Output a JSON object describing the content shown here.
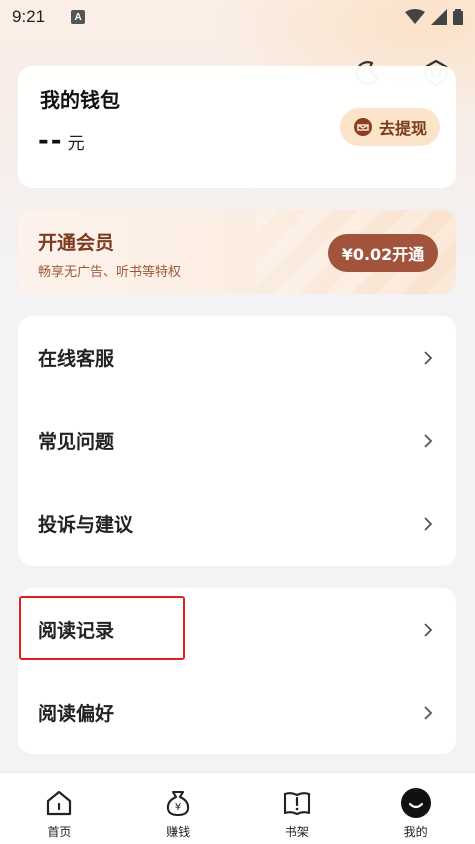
{
  "status_bar": {
    "time": "9:21",
    "notification_letter": "A"
  },
  "header": {
    "icons": [
      "moon-icon",
      "settings-icon"
    ]
  },
  "wallet": {
    "title": "我的钱包",
    "amount": "--",
    "unit": "元",
    "withdraw_label": "去提现",
    "withdraw_icon": "wallet-chat-icon"
  },
  "vip": {
    "title": "开通会员",
    "subtitle": "畅享无广告、听书等特权",
    "button_label": "¥0.02开通"
  },
  "menu_group_1": [
    {
      "label": "在线客服"
    },
    {
      "label": "常见问题"
    },
    {
      "label": "投诉与建议"
    }
  ],
  "menu_group_2": [
    {
      "label": "阅读记录"
    },
    {
      "label": "阅读偏好"
    }
  ],
  "tabs": [
    {
      "label": "首页",
      "icon": "home-icon"
    },
    {
      "label": "赚钱",
      "icon": "money-bag-icon"
    },
    {
      "label": "书架",
      "icon": "bookshelf-icon"
    },
    {
      "label": "我的",
      "icon": "profile-icon",
      "active": true
    }
  ],
  "colors": {
    "accent_brown": "#a1543b",
    "withdraw_bg": "#fbe4c9",
    "highlight_red": "#e02020"
  }
}
